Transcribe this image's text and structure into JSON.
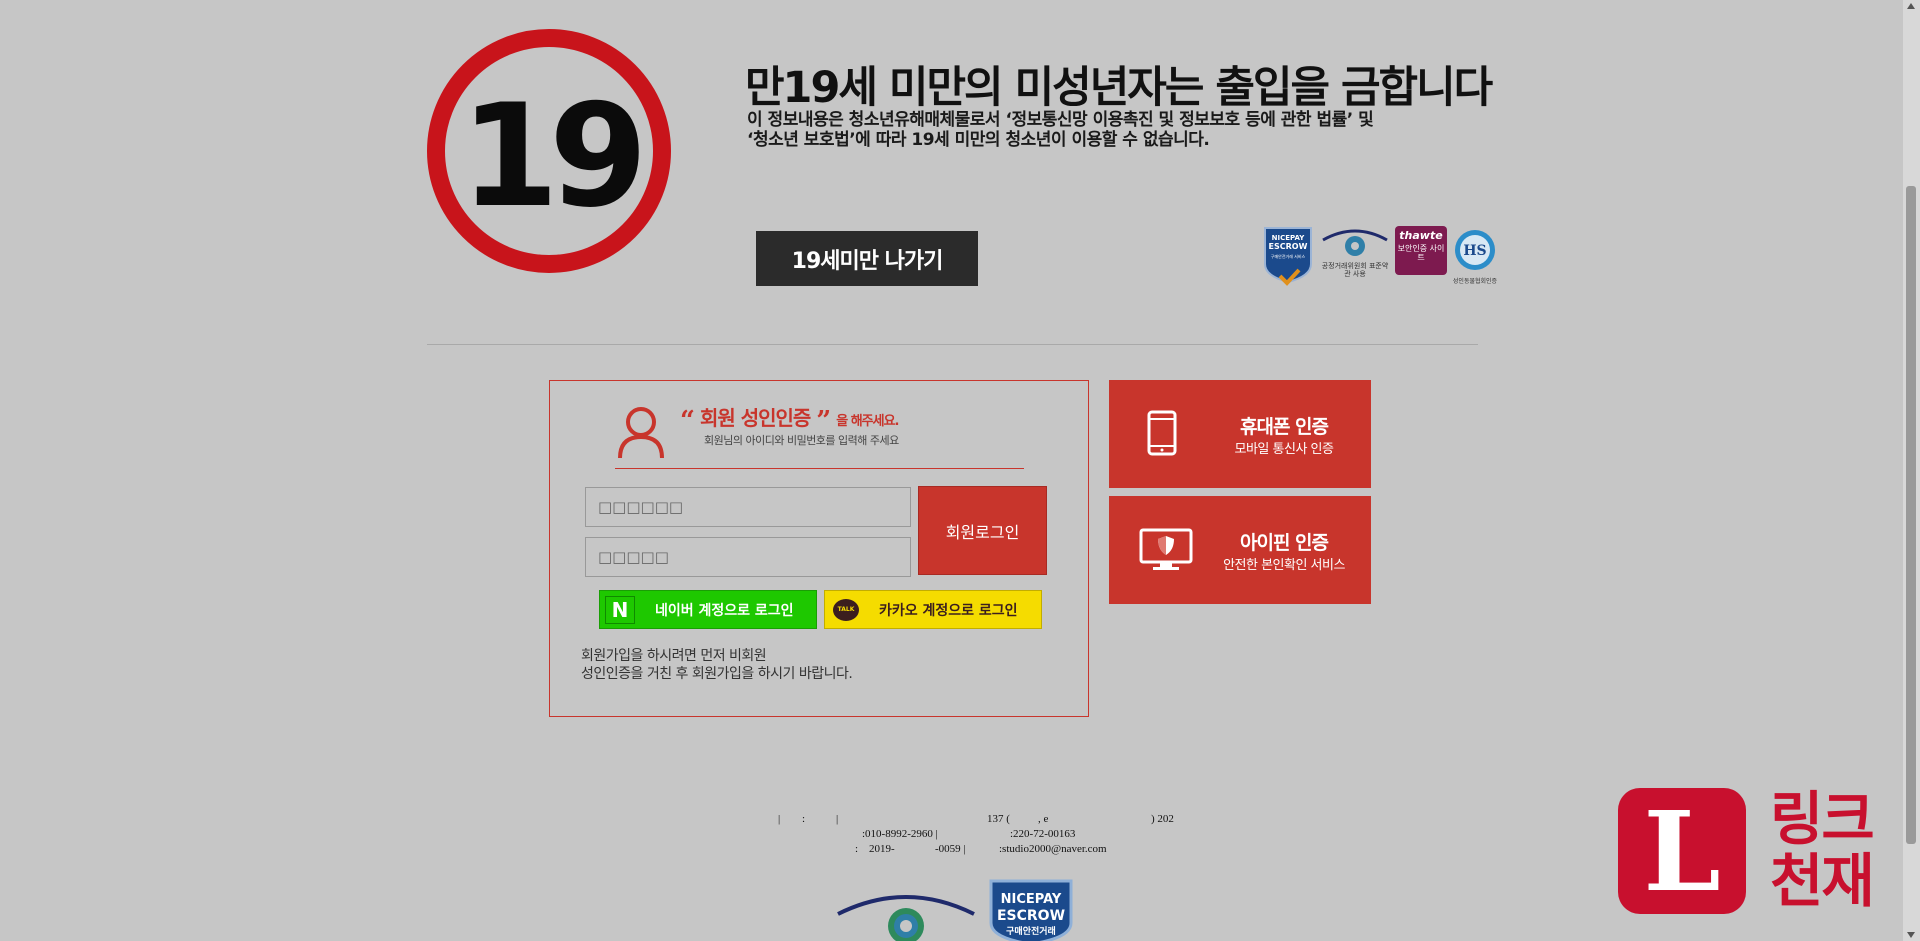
{
  "age_badge": {
    "number": "19"
  },
  "warning": {
    "title": "만19세 미만의 미성년자는 출입을 금합니다",
    "line1": "이 정보내용은 청소년유해매체물로서 ‘정보통신망 이용촉진 및 정보보호 등에 관한 법률’ 및",
    "line2": "‘청소년 보호법’에 따라 19세 미만의 청소년이 이용할 수 없습니다.",
    "exit_button": "19세미만 나가기"
  },
  "certs": {
    "nice": {
      "l1": "NICEPAY",
      "l2": "ESCROW",
      "l3": "구매안전거래 서비스"
    },
    "ftc": {
      "caption": "공정거래위원회 표준약관 사용"
    },
    "thawte": {
      "brand": "thawte",
      "caption": "보안인증 사이트"
    },
    "hs": {
      "mark": "HS",
      "caption": "성인동물협회인증"
    }
  },
  "login": {
    "title_open_quote": "“",
    "title": "회원 성인인증",
    "title_close_quote": "”",
    "title_suffix": "을 해주세요.",
    "subtitle": "회원님의 아이디와 비밀번호를 입력해 주세요",
    "id_placeholder": "□□□□□□",
    "pw_placeholder": "□□□□□",
    "login_button": "회원로그인",
    "naver_mark": "N",
    "naver_label": "네이버 계정으로 로그인",
    "kakao_mark": "TALK",
    "kakao_label": "카카오 계정으로 로그인",
    "note_line1": "회원가입을 하시려면 먼저 비회원",
    "note_line2": "성인인증을 거친 후 회원가입을 하시기 바랍니다."
  },
  "auth": {
    "phone": {
      "title": "휴대폰 인증",
      "sub": "모바일 통신사 인증"
    },
    "ipin": {
      "title": "아이핀 인증",
      "sub": "안전한 본인확인 서비스"
    }
  },
  "footer": {
    "seg1": "|",
    "seg2": ":",
    "seg3": "|",
    "seg4": "137 (",
    "seg5": ", e",
    "seg6": ") 202",
    "phone": ":010-8992-2960 |",
    "biz": ":220-72-00163",
    "reg_a": ":",
    "reg_b": "2019-",
    "reg_c": "-0059 |",
    "email": ":studio2000@naver.com",
    "nice_l1": "NICEPAY",
    "nice_l2": "ESCROW",
    "nice_l3": "구매안전거래"
  },
  "watermark": {
    "letter": "L",
    "line1": "링크",
    "line2": "천재"
  },
  "colors": {
    "accent": "#c8352c",
    "naver": "#1ec800",
    "kakao": "#f5dc00",
    "background": "#c6c6c6"
  }
}
